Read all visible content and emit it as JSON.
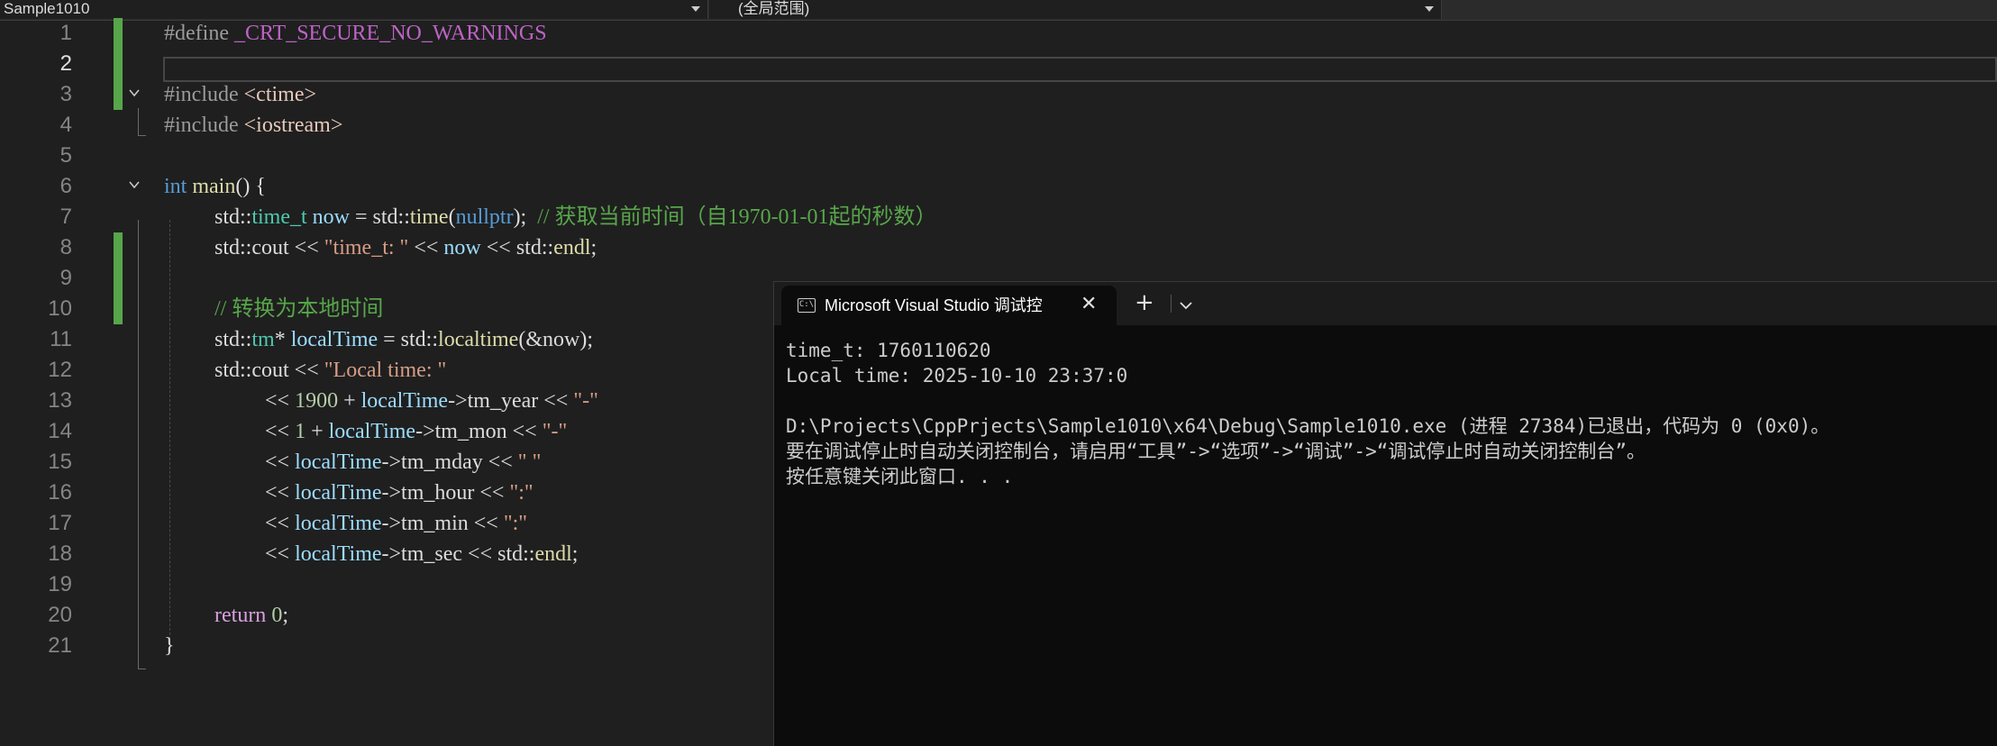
{
  "navbar": {
    "project": "Sample1010",
    "scope": "(全局范围)"
  },
  "editor": {
    "line_numbers": [
      "1",
      "2",
      "3",
      "4",
      "5",
      "6",
      "7",
      "8",
      "9",
      "10",
      "11",
      "12",
      "13",
      "14",
      "15",
      "16",
      "17",
      "18",
      "19",
      "20",
      "21"
    ],
    "code": {
      "l1_directive": "#define",
      "l1_macro": "_CRT_SECURE_NO_WARNINGS",
      "l3_directive": "#include",
      "l3_header": "<ctime>",
      "l4_directive": "#include",
      "l4_header": "<iostream>",
      "l6_kw": "int",
      "l6_fn": "main",
      "l6_rest": "() {",
      "l7_ns": "std::",
      "l7_type": "time_t",
      "l7_var": "now",
      "l7_eq": " = std::",
      "l7_fn": "time",
      "l7_p1": "(",
      "l7_kw": "nullptr",
      "l7_p2": ");",
      "l7_comment": "// 获取当前时间（自1970-01-01起的秒数）",
      "l8_a": "std::",
      "l8_b": "cout",
      "l8_op": " << ",
      "l8_str": "\"time_t: \"",
      "l8_op2": " << ",
      "l8_var": "now",
      "l8_op3": " << std::",
      "l8_fn": "endl",
      "l8_end": ";",
      "l10_comment": "// 转换为本地时间",
      "l11_ns": "std::",
      "l11_type": "tm",
      "l11_star": "* ",
      "l11_var": "localTime",
      "l11_eq": " = std::",
      "l11_fn": "localtime",
      "l11_args": "(&now);",
      "l12_a": "std::cout << ",
      "l12_str": "\"Local time: \"",
      "l13_a": "<< ",
      "l13_num": "1900",
      "l13_b": " + ",
      "l13_var": "localTime",
      "l13_c": "->tm_year << ",
      "l13_str": "\"-\"",
      "l14_a": "<< ",
      "l14_num": "1",
      "l14_b": " + ",
      "l14_var": "localTime",
      "l14_c": "->tm_mon << ",
      "l14_str": "\"-\"",
      "l15_a": "<< ",
      "l15_var": "localTime",
      "l15_c": "->tm_mday << ",
      "l15_str": "\" \"",
      "l16_a": "<< ",
      "l16_var": "localTime",
      "l16_c": "->tm_hour << ",
      "l16_str": "\":\"",
      "l17_a": "<< ",
      "l17_var": "localTime",
      "l17_c": "->tm_min << ",
      "l17_str": "\":\"",
      "l18_a": "<< ",
      "l18_var": "localTime",
      "l18_c": "->tm_sec << std::",
      "l18_fn": "endl",
      "l18_end": ";",
      "l20_kw": "return",
      "l20_num": "0",
      "l20_end": ";",
      "l21": "}"
    }
  },
  "console": {
    "tab_title": "Microsoft Visual Studio 调试控",
    "icon_text": "C:\\",
    "close_glyph": "✕",
    "plus_glyph": "+",
    "dropdown_glyph": "⌄",
    "output": [
      "time_t: 1760110620",
      "Local time: 2025-10-10 23:37:0",
      "",
      "D:\\Projects\\CppPrjects\\Sample1010\\x64\\Debug\\Sample1010.exe (进程 27384)已退出，代码为 0 (0x0)。",
      "要在调试停止时自动关闭控制台，请启用“工具”->“选项”->“调试”->“调试停止时自动关闭控制台”。",
      "按任意键关闭此窗口. . ."
    ]
  },
  "colors": {
    "editor_bg": "#1f1f1f",
    "console_bg": "#0c0c0c",
    "change_marker": "#57a64a",
    "keyword": "#569cd6",
    "comment": "#57a64a",
    "string": "#d69d85"
  }
}
